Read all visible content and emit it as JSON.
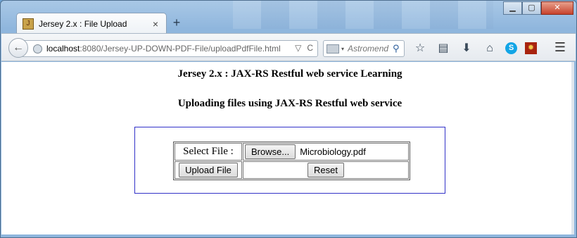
{
  "browser": {
    "tab": {
      "title": "Jersey 2.x : File Upload",
      "close_glyph": "×",
      "favicon": "J"
    },
    "new_tab_glyph": "+",
    "window_controls": {
      "minimize": "▁",
      "maximize": "▢",
      "close": "✕"
    },
    "nav": {
      "back_glyph": "←",
      "url_host": "localhost",
      "url_path": ":8080/Jersey-UP-DOWN-PDF-File/uploadPdfFile.html",
      "url_icons": [
        "▽",
        "C"
      ]
    },
    "search": {
      "placeholder": "Astromend",
      "go_glyph": "⚲"
    },
    "toolbar_icons": [
      {
        "name": "bookmark-star-icon",
        "glyph": "☆"
      },
      {
        "name": "reading-list-icon",
        "glyph": "▤"
      },
      {
        "name": "download-icon",
        "glyph": "⬇"
      },
      {
        "name": "home-icon",
        "glyph": "⌂"
      },
      {
        "name": "skype-icon",
        "glyph": "S"
      },
      {
        "name": "addon-icon",
        "glyph": "✹"
      }
    ],
    "menu_glyph": "☰"
  },
  "page": {
    "heading": "Jersey 2.x : JAX-RS Restful web service Learning",
    "subheading": "Uploading files using JAX-RS Restful web service",
    "form": {
      "select_label": "Select File :",
      "browse_label": "Browse...",
      "selected_file": "Microbiology.pdf",
      "upload_label": "Upload File",
      "reset_label": "Reset"
    }
  },
  "colors": {
    "form_border": "#3232c8",
    "titlebar": "#8fb6dd"
  }
}
